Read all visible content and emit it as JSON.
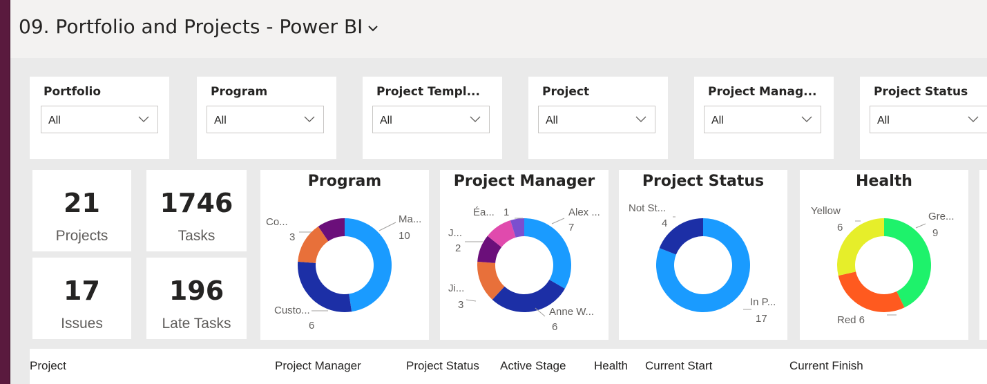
{
  "report": {
    "title": "09. Portfolio and Projects - Power BI"
  },
  "slicers": [
    {
      "label": "Portfolio",
      "value": "All"
    },
    {
      "label": "Program",
      "value": "All"
    },
    {
      "label": "Project Templ...",
      "value": "All"
    },
    {
      "label": "Project",
      "value": "All"
    },
    {
      "label": "Project Manag...",
      "value": "All"
    },
    {
      "label": "Project Status",
      "value": "All"
    }
  ],
  "kpis": {
    "projects": {
      "value": "21",
      "label": "Projects"
    },
    "tasks": {
      "value": "1746",
      "label": "Tasks"
    },
    "issues": {
      "value": "17",
      "label": "Issues"
    },
    "late_tasks": {
      "value": "196",
      "label": "Late Tasks"
    }
  },
  "chart_data": [
    {
      "type": "donut",
      "title": "Program",
      "slices": [
        {
          "label": "Ma...",
          "value": 10,
          "color": "#1a9bff"
        },
        {
          "label": "Custo...",
          "value": 6,
          "color": "#1c2fa6"
        },
        {
          "label": "Co...",
          "value": 3,
          "color": "#e8703a"
        },
        {
          "label": "",
          "value": 2,
          "color": "#6b0f7a"
        }
      ],
      "labels": [
        {
          "name": "Ma...",
          "value": "10"
        },
        {
          "name": "Custo...",
          "value": "6"
        },
        {
          "name": "Co...",
          "value": "3"
        }
      ]
    },
    {
      "type": "donut",
      "title": "Project Manager",
      "slices": [
        {
          "label": "Alex ...",
          "value": 7,
          "color": "#1a9bff"
        },
        {
          "label": "Anne W...",
          "value": 6,
          "color": "#1c2fa6"
        },
        {
          "label": "Ji...",
          "value": 3,
          "color": "#e8703a"
        },
        {
          "label": "J...",
          "value": 2,
          "color": "#6b0f7a"
        },
        {
          "label": "",
          "value": 2,
          "color": "#e04aad"
        },
        {
          "label": "Éa...",
          "value": 1,
          "color": "#7b4fcf"
        }
      ],
      "labels": [
        {
          "name": "Alex ...",
          "value": "7"
        },
        {
          "name": "Anne W...",
          "value": "6"
        },
        {
          "name": "Ji...",
          "value": "3"
        },
        {
          "name": "J...",
          "value": "2"
        },
        {
          "name": "Éa...",
          "value": "1"
        }
      ]
    },
    {
      "type": "donut",
      "title": "Project Status",
      "slices": [
        {
          "label": "In P...",
          "value": 17,
          "color": "#1a9bff"
        },
        {
          "label": "Not St...",
          "value": 4,
          "color": "#1c2fa6"
        }
      ],
      "labels": [
        {
          "name": "In P...",
          "value": "17"
        },
        {
          "name": "Not St...",
          "value": "4"
        }
      ]
    },
    {
      "type": "donut",
      "title": "Health",
      "slices": [
        {
          "label": "Gre...",
          "value": 9,
          "color": "#1ef26b"
        },
        {
          "label": "Red",
          "value": 6,
          "color": "#ff5a1f"
        },
        {
          "label": "Yellow",
          "value": 6,
          "color": "#e6ee2a"
        }
      ],
      "labels": [
        {
          "name": "Gre...",
          "value": "9"
        },
        {
          "name": "Red 6",
          "value": ""
        },
        {
          "name": "Yellow",
          "value": "6"
        }
      ]
    }
  ],
  "table": {
    "columns": [
      "Project",
      "Project Manager",
      "Project Status",
      "Active Stage",
      "Health",
      "Current Start",
      "Current Finish"
    ]
  }
}
